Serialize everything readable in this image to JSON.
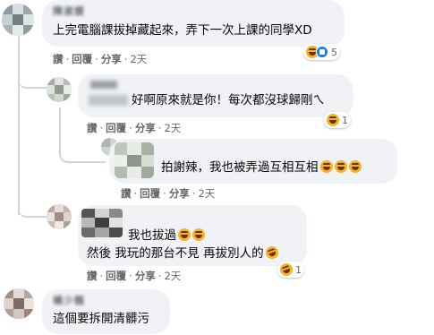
{
  "thread": {
    "comments": [
      {
        "id": "c1",
        "author": "陳淑媛",
        "text": "上完電腦課拔掉藏起來，弄下一次上課的同學XD",
        "actions": {
          "like": "讚",
          "reply": "回覆",
          "share": "分享",
          "time": "2天"
        },
        "reactions": {
          "count": "5",
          "icons": [
            "haha-icon",
            "like-icon"
          ]
        }
      },
      {
        "id": "r1",
        "author": "",
        "text": "好啊原來就是你！每次都沒球歸剛ㄟ",
        "actions": {
          "like": "讚",
          "reply": "回覆",
          "share": "分享",
          "time": "2天"
        },
        "reactions": {
          "count": "1",
          "icons": [
            "haha-icon"
          ]
        }
      },
      {
        "id": "r2",
        "author": "",
        "text": "拍謝辣，我也被弄過互相互相",
        "actions": {
          "like": "讚",
          "reply": "回覆",
          "share": "分享",
          "time": "2天"
        }
      },
      {
        "id": "r3",
        "author": "",
        "line1": "我也拔過",
        "line2": "然後 我玩的那台不見 再拔別人的",
        "actions": {
          "like": "讚",
          "reply": "回覆",
          "share": "分享",
          "time": "2天"
        },
        "reactions": {
          "count": "1",
          "icons": [
            "rofl-icon"
          ]
        }
      },
      {
        "id": "c2",
        "author": "楊少龍",
        "text": "這個要拆開清髒污"
      }
    ]
  },
  "colors": {
    "bubble": "#f0f2f5",
    "meta_text": "#65676b",
    "thread_line": "#d0d3d8",
    "haha": "#f7b125",
    "like": "#1877f2"
  }
}
